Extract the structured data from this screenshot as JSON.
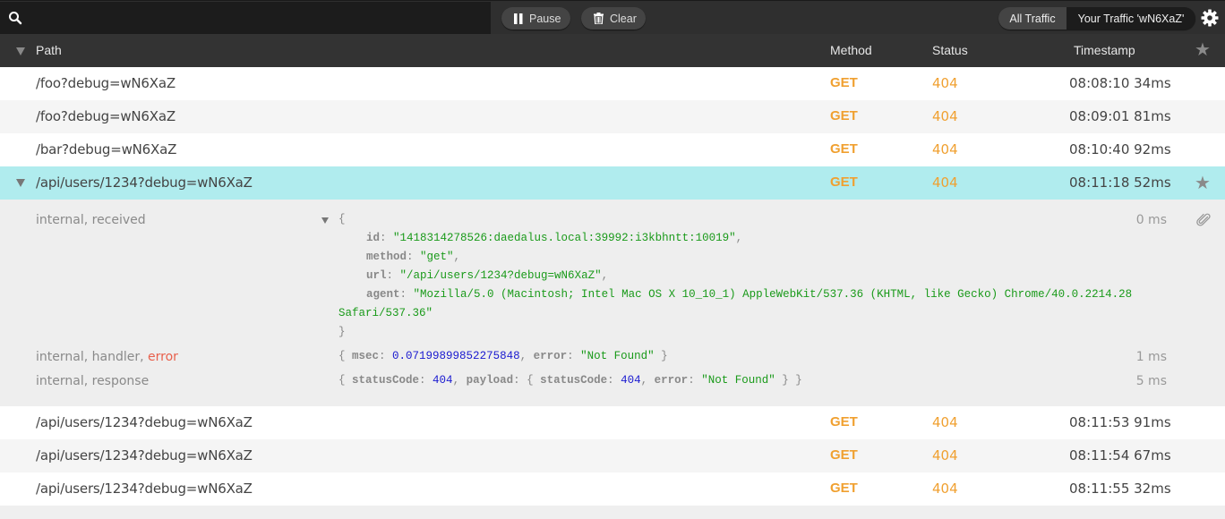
{
  "toolbar": {
    "search_placeholder": "",
    "search_value": "",
    "pause_label": "Pause",
    "clear_label": "Clear",
    "traffic_filter": {
      "options": [
        "All Traffic",
        "Your Traffic 'wN6XaZ'"
      ],
      "selected": "Your Traffic 'wN6XaZ'"
    },
    "icons": {
      "search": "search-icon",
      "pause": "pause-icon",
      "clear": "trash-icon",
      "settings": "gear-icon"
    }
  },
  "table": {
    "columns": {
      "path": "Path",
      "method": "Method",
      "status": "Status",
      "timestamp": "Timestamp"
    },
    "colors": {
      "method": "#f0a030",
      "status": "#f0a030",
      "selected_row": "#b0ecee"
    },
    "rows_before": [
      {
        "path": "/foo?debug=wN6XaZ",
        "method": "GET",
        "status": "404",
        "timestamp": "08:08:10 34ms"
      },
      {
        "path": "/foo?debug=wN6XaZ",
        "method": "GET",
        "status": "404",
        "timestamp": "08:09:01 81ms"
      },
      {
        "path": "/bar?debug=wN6XaZ",
        "method": "GET",
        "status": "404",
        "timestamp": "08:10:40 92ms"
      }
    ],
    "selected_row": {
      "path": "/api/users/1234?debug=wN6XaZ",
      "method": "GET",
      "status": "404",
      "timestamp": "08:11:18 52ms",
      "starred": true,
      "expanded": true
    },
    "rows_after": [
      {
        "path": "/api/users/1234?debug=wN6XaZ",
        "method": "GET",
        "status": "404",
        "timestamp": "08:11:53 91ms"
      },
      {
        "path": "/api/users/1234?debug=wN6XaZ",
        "method": "GET",
        "status": "404",
        "timestamp": "08:11:54 67ms"
      },
      {
        "path": "/api/users/1234?debug=wN6XaZ",
        "method": "GET",
        "status": "404",
        "timestamp": "08:11:55 32ms"
      }
    ]
  },
  "details": {
    "events": [
      {
        "tags": "internal, received",
        "time": "0 ms",
        "open_brace": "{",
        "fields": [
          {
            "key": "id",
            "value": "\"1418314278526:daedalus.local:39992:i3kbhntt:10019\""
          },
          {
            "key": "method",
            "value": "\"get\""
          },
          {
            "key": "url",
            "value": "\"/api/users/1234?debug=wN6XaZ\""
          },
          {
            "key": "agent",
            "value": "\"Mozilla/5.0 (Macintosh; Intel Mac OS X 10_10_1) AppleWebKit/537.36 (KHTML, like Gecko) Chrome/40.0.2214.28",
            "continuation": "Safari/537.36\""
          }
        ],
        "close_brace": "}"
      },
      {
        "tags_prefix": "internal, handler, ",
        "tags_error": "error",
        "time": "1 ms",
        "summary": {
          "msec": "0.07199899852275848",
          "error": "\"Not Found\""
        }
      },
      {
        "tags": "internal, response",
        "time": "5 ms",
        "summary": {
          "statusCode": "404",
          "payload_statusCode": "404",
          "payload_error": "\"Not Found\""
        }
      }
    ]
  }
}
